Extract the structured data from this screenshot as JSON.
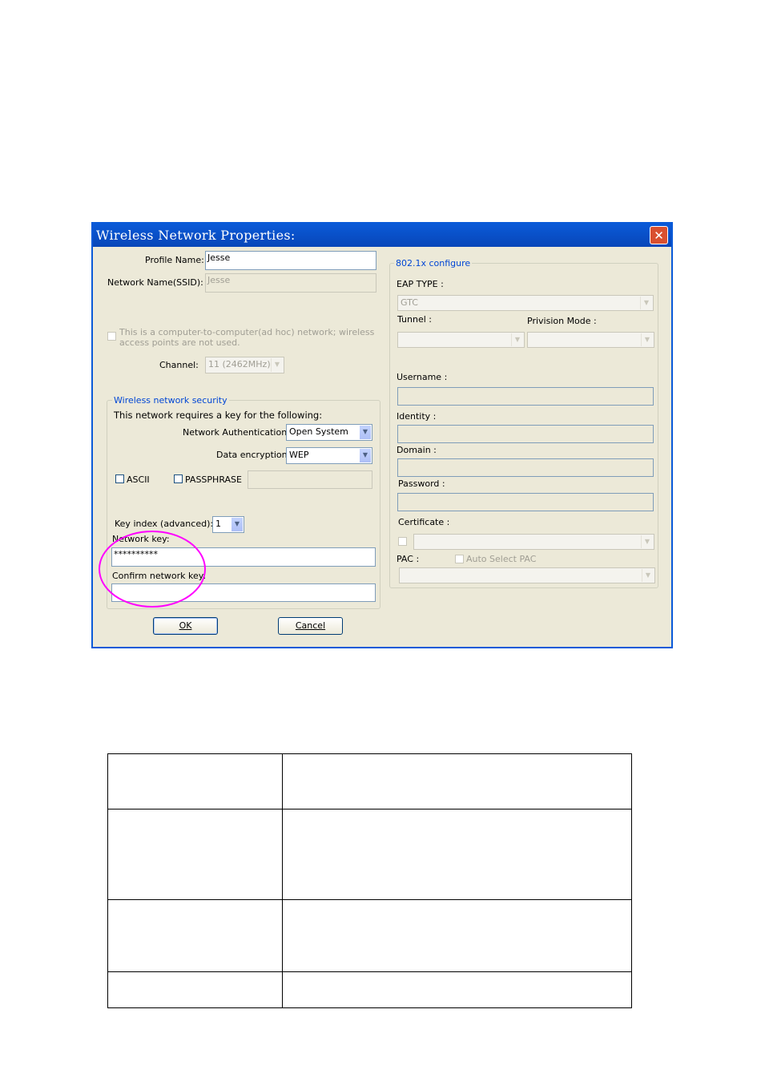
{
  "dialog": {
    "title": "Wireless Network Properties:",
    "close_glyph": "✕",
    "profile_name_label": "Profile Name:",
    "profile_name_value": "Jesse",
    "ssid_label": "Network Name(SSID):",
    "ssid_value": "Jesse",
    "adhoc_label_line1": "This is a computer-to-computer(ad hoc) network; wireless",
    "adhoc_label_line2": "access points are not used.",
    "channel_label": "Channel:",
    "channel_value": "11 (2462MHz)"
  },
  "security": {
    "legend": "Wireless network security",
    "requires_text": "This network requires a key for the following:",
    "auth_label": "Network Authentication:",
    "auth_value": "Open System",
    "encryption_label": "Data encryption:",
    "encryption_value": "WEP",
    "ascii_label": "ASCII",
    "passphrase_label": "PASSPHRASE",
    "key_index_label": "Key index (advanced):",
    "key_index_value": "1",
    "network_key_label": "Network key:",
    "network_key_value": "**********",
    "confirm_key_label": "Confirm network key:",
    "confirm_key_value": ""
  },
  "dot1x": {
    "legend": "802.1x configure",
    "eap_type_label": "EAP TYPE :",
    "eap_type_value": "GTC",
    "tunnel_label": "Tunnel :",
    "provision_label": "Privision Mode :",
    "username_label": "Username :",
    "identity_label": "Identity :",
    "domain_label": "Domain :",
    "password_label": "Password :",
    "certificate_label": "Certificate :",
    "pac_label": "PAC :",
    "auto_pac_label": "Auto Select PAC"
  },
  "buttons": {
    "ok": "OK",
    "cancel": "Cancel"
  },
  "info_table": {
    "rows": [
      {
        "col1": "",
        "col2": ""
      },
      {
        "col1": "",
        "col2": ""
      },
      {
        "col1": "",
        "col2": ""
      },
      {
        "col1": "",
        "col2": ""
      }
    ]
  },
  "colors": {
    "title_bar": "#0a5ad8",
    "dialog_face": "#ece9d8",
    "legend_text": "#0046d5",
    "highlight_circle": "#ff00ff"
  }
}
